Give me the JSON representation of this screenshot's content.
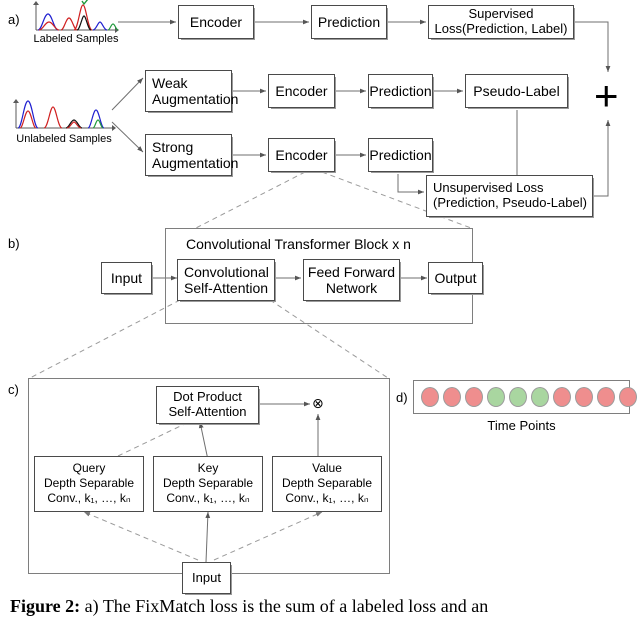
{
  "figure": {
    "caption_bold": "Figure 2:",
    "caption_text": " a) The FixMatch loss is the sum of a labeled loss and an"
  },
  "panels": {
    "a": {
      "label": "a)"
    },
    "b": {
      "label": "b)"
    },
    "c": {
      "label": "c)"
    },
    "d": {
      "label": "d)"
    }
  },
  "panel_a": {
    "labeled_samples_caption": "Labeled Samples",
    "unlabeled_samples_caption": "Unlabeled Samples",
    "encoder_top": "Encoder",
    "prediction_top": "Prediction",
    "supervised_loss": "Supervised Loss(Prediction, Label)",
    "weak_augmentation": "Weak\nAugmentation",
    "strong_augmentation": "Strong\nAugmentation",
    "encoder_weak": "Encoder",
    "prediction_weak": "Prediction",
    "pseudo_label": "Pseudo-Label",
    "encoder_strong": "Encoder",
    "prediction_strong": "Prediction",
    "unsupervised_loss": "Unsupervised Loss\n(Prediction, Pseudo-Label)",
    "plus_sign": "+"
  },
  "panel_b": {
    "block_title": "Convolutional Transformer Block x n",
    "input": "Input",
    "conv_self_attention": "Convolutional\nSelf-Attention",
    "feed_forward": "Feed Forward\nNetwork",
    "output": "Output"
  },
  "panel_c": {
    "dot_product_self_attention": "Dot Product\nSelf-Attention",
    "otimes_symbol": "⊗",
    "query_line1": "Query",
    "query_line2": "Depth Separable",
    "key_line1": "Key",
    "key_line2": "Depth Separable",
    "value_line1": "Value",
    "value_line2": "Depth Separable",
    "conv_kernels_line": "Conv., k₁, …, kₙ",
    "input": "Input"
  },
  "panel_d": {
    "time_points_label": "Time Points",
    "dots": [
      "red",
      "red",
      "red",
      "green",
      "green",
      "green",
      "red",
      "red",
      "red",
      "red"
    ]
  },
  "colors": {
    "dot_red": "#ef8e8e",
    "dot_green": "#a9d6a0",
    "box_border": "#4a4a4a",
    "group_border": "#7e7e7e",
    "arrow": "#6f6f6f",
    "dashed": "#9a9a9a",
    "signal_blue": "#2020d0",
    "signal_red": "#d02020",
    "signal_green": "#1f9a3c",
    "signal_black": "#101010"
  }
}
